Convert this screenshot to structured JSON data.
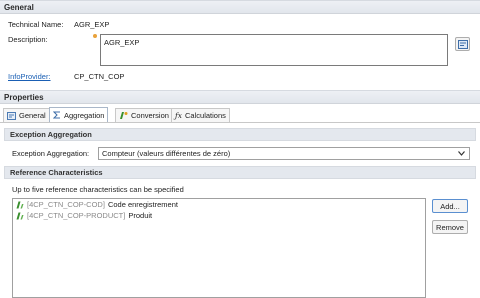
{
  "general": {
    "header": "General",
    "technical_name_label": "Technical Name:",
    "technical_name_value": "AGR_EXP",
    "description_label": "Description:",
    "description_value": "AGR_EXP",
    "infoprovider_label": "InfoProvider:",
    "infoprovider_value": "CP_CTN_COP"
  },
  "properties": {
    "header": "Properties",
    "tabs": [
      {
        "label": "General",
        "icon": "general-tab-icon"
      },
      {
        "label": "Aggregation",
        "icon": "sigma-icon",
        "active": true
      },
      {
        "label": "Conversion",
        "icon": "conversion-icon"
      },
      {
        "label": "Calculations",
        "icon": "fx-icon"
      }
    ]
  },
  "exception_aggregation": {
    "header": "Exception Aggregation",
    "label": "Exception Aggregation:",
    "selected": "Compteur (valeurs différentes de zéro)"
  },
  "reference_characteristics": {
    "header": "Reference Characteristics",
    "hint": "Up to five reference characteristics can be specified",
    "items": [
      {
        "tech": "[4CP_CTN_COP-COD]",
        "text": "Code enregistrement"
      },
      {
        "tech": "[4CP_CTN_COP-PRODUCT]",
        "text": "Produit"
      }
    ],
    "add_label": "Add...",
    "remove_label": "Remove"
  },
  "colors": {
    "link": "#1a5fb4",
    "characteristic_icon": "#3a8f2e"
  }
}
